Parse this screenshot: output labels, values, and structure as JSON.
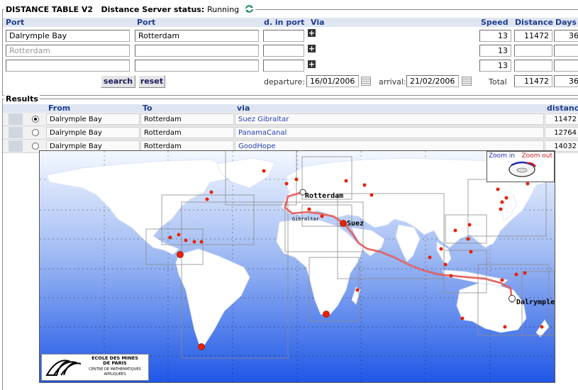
{
  "app": {
    "title": "DISTANCE TABLE V2",
    "server_label": "Distance Server status:",
    "server_status": "Running"
  },
  "columns": {
    "port_from": "Port",
    "port_to": "Port",
    "days_in_port": "d. in port",
    "via": "Via",
    "speed": "Speed",
    "distance": "Distance",
    "days": "Days"
  },
  "legs": [
    {
      "from": "Dalrymple Bay",
      "to": "Rotterdam",
      "days_in_port": "",
      "speed": "13",
      "distance": "11472",
      "days": "36"
    },
    {
      "from": "Rotterdam",
      "to": "",
      "days_in_port": "",
      "speed": "13",
      "distance": "",
      "days": ""
    },
    {
      "from": "",
      "to": "",
      "days_in_port": "",
      "speed": "13",
      "distance": "",
      "days": ""
    }
  ],
  "buttons": {
    "search": "search",
    "reset": "reset"
  },
  "dates": {
    "departure_label": "departure:",
    "departure": "16/01/2006",
    "arrival_label": "arrival:",
    "arrival": "21/02/2006"
  },
  "total": {
    "label": "Total",
    "distance": "11472",
    "days": "36"
  },
  "results": {
    "title": "Results",
    "headers": {
      "from": "From",
      "to": "To",
      "via": "via",
      "distance": "distance"
    },
    "rows": [
      {
        "from": "Dalrymple Bay",
        "to": "Rotterdam",
        "via": "Suez Gibraltar",
        "distance": "11472",
        "selected": true
      },
      {
        "from": "Dalrymple Bay",
        "to": "Rotterdam",
        "via": "PanamaCanal",
        "distance": "12764",
        "selected": false
      },
      {
        "from": "Dalrymple Bay",
        "to": "Rotterdam",
        "via": "GoodHope",
        "distance": "14032",
        "selected": false
      }
    ]
  },
  "map": {
    "zoom_in": "Zoom in",
    "zoom_out": "Zoom out",
    "labels": {
      "rotterdam": "Rotterdam",
      "suez": "Suez",
      "gibraltar": "Gibraltar",
      "dalrymple": "Dalrymple"
    },
    "logo_lines": [
      "ECOLE DES MINES",
      "DE PARIS",
      "CENTRE DE MATHEMATIQUES",
      "APPLIQUEES"
    ],
    "colors": {
      "ocean_top": "#f4f8ff",
      "ocean_bottom": "#1f57e6",
      "land": "#ffffff",
      "route": "#d93a3a",
      "port": "#e62200"
    }
  }
}
